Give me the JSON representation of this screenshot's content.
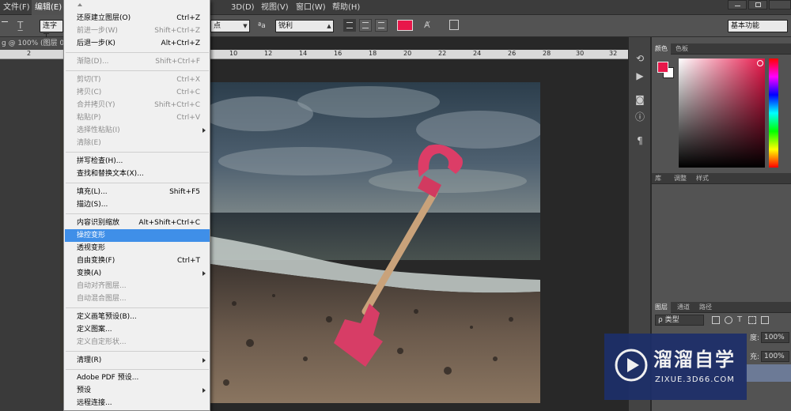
{
  "menubar": {
    "items": [
      "文件(F)",
      "编辑(E)",
      "3D(D)",
      "视图(V)",
      "窗口(W)",
      "帮助(H)"
    ]
  },
  "options": {
    "tool_field": "连字工",
    "size_field": "点",
    "aa_label": "ªa",
    "aa_value": "锐利",
    "workspace": "基本功能",
    "text_color": "#e8174a"
  },
  "document": {
    "tab_title": "g @ 100% (图层 0,",
    "ruler_left": [
      "2"
    ],
    "ruler_ticks": [
      "10",
      "12",
      "14",
      "16",
      "18",
      "20",
      "22",
      "24",
      "26",
      "28",
      "30",
      "32"
    ]
  },
  "edit_menu": {
    "items": [
      {
        "label": "还原建立图层(O)",
        "shortcut": "Ctrl+Z",
        "disabled": false
      },
      {
        "label": "前进一步(W)",
        "shortcut": "Shift+Ctrl+Z",
        "disabled": true
      },
      {
        "label": "后退一步(K)",
        "shortcut": "Alt+Ctrl+Z",
        "disabled": false
      },
      {
        "label": "渐隐(D)...",
        "shortcut": "Shift+Ctrl+F",
        "disabled": true
      },
      {
        "label": "剪切(T)",
        "shortcut": "Ctrl+X",
        "disabled": true
      },
      {
        "label": "拷贝(C)",
        "shortcut": "Ctrl+C",
        "disabled": true
      },
      {
        "label": "合并拷贝(Y)",
        "shortcut": "Shift+Ctrl+C",
        "disabled": true
      },
      {
        "label": "粘贴(P)",
        "shortcut": "Ctrl+V",
        "disabled": true
      },
      {
        "label": "选择性粘贴(I)",
        "shortcut": "",
        "disabled": true
      },
      {
        "label": "清除(E)",
        "shortcut": "",
        "disabled": true
      },
      {
        "label": "拼写检查(H)...",
        "shortcut": "",
        "disabled": false
      },
      {
        "label": "查找和替换文本(X)...",
        "shortcut": "",
        "disabled": false
      },
      {
        "label": "填充(L)...",
        "shortcut": "Shift+F5",
        "disabled": false
      },
      {
        "label": "描边(S)...",
        "shortcut": "",
        "disabled": false
      },
      {
        "label": "内容识别缩放",
        "shortcut": "Alt+Shift+Ctrl+C",
        "disabled": false
      },
      {
        "label": "操控变形",
        "shortcut": "",
        "disabled": false
      },
      {
        "label": "透视变形",
        "shortcut": "",
        "disabled": false
      },
      {
        "label": "自由变换(F)",
        "shortcut": "Ctrl+T",
        "disabled": false
      },
      {
        "label": "变换(A)",
        "shortcut": "",
        "disabled": false
      },
      {
        "label": "自动对齐图层...",
        "shortcut": "",
        "disabled": true
      },
      {
        "label": "自动混合图层...",
        "shortcut": "",
        "disabled": true
      },
      {
        "label": "定义画笔预设(B)...",
        "shortcut": "",
        "disabled": false
      },
      {
        "label": "定义图案...",
        "shortcut": "",
        "disabled": false
      },
      {
        "label": "定义自定形状...",
        "shortcut": "",
        "disabled": true
      },
      {
        "label": "清理(R)",
        "shortcut": "",
        "disabled": false
      },
      {
        "label": "Adobe PDF 预设...",
        "shortcut": "",
        "disabled": false
      },
      {
        "label": "预设",
        "shortcut": "",
        "disabled": false
      },
      {
        "label": "远程连接...",
        "shortcut": "",
        "disabled": false
      }
    ]
  },
  "color_panel": {
    "tabs": [
      "颜色",
      "色板"
    ],
    "foreground": "#e8174a",
    "background": "#ffffff"
  },
  "adjust_panel": {
    "tabs": [
      "库",
      "调整",
      "样式"
    ]
  },
  "layers_panel": {
    "tabs": [
      "图层",
      "通道",
      "路径"
    ],
    "filter_label": "ρ 类型",
    "opacity_label": "度:",
    "opacity_value": "100%",
    "fill_label": "充:",
    "fill_value": "100%"
  },
  "watermark": {
    "title": "溜溜自学",
    "url": "ZIXUE.3D66.COM"
  }
}
